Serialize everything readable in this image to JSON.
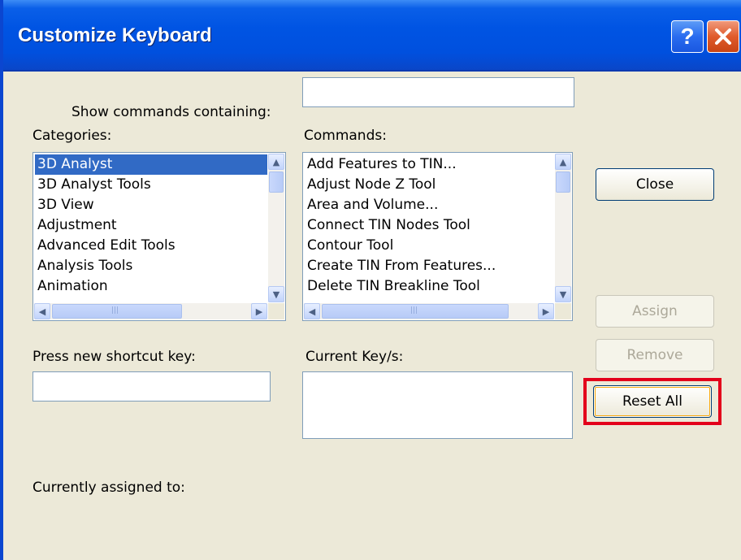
{
  "window": {
    "title": "Customize Keyboard",
    "help_symbol": "?",
    "close_symbol": "×"
  },
  "search": {
    "label": "Show commands containing:",
    "value": ""
  },
  "categories": {
    "label": "Categories:",
    "items": [
      "3D Analyst",
      "3D Analyst Tools",
      "3D View",
      "Adjustment",
      "Advanced Edit Tools",
      "Analysis Tools",
      "Animation"
    ],
    "selected": "3D Analyst"
  },
  "commands": {
    "label": "Commands:",
    "items": [
      "Add Features to TIN...",
      "Adjust Node Z Tool",
      "Area and Volume...",
      "Connect TIN Nodes Tool",
      "Contour Tool",
      "Create TIN From Features...",
      "Delete TIN Breakline Tool"
    ]
  },
  "shortcut": {
    "label": "Press new shortcut key:",
    "value": ""
  },
  "current_keys": {
    "label": "Current Key/s:"
  },
  "assigned": {
    "label": "Currently assigned to:"
  },
  "buttons": {
    "close": "Close",
    "assign": "Assign",
    "remove": "Remove",
    "reset_all": "Reset All"
  },
  "colors": {
    "titlebar": "#0054e3",
    "selection": "#316ac5",
    "highlight_box": "#e3001b"
  }
}
